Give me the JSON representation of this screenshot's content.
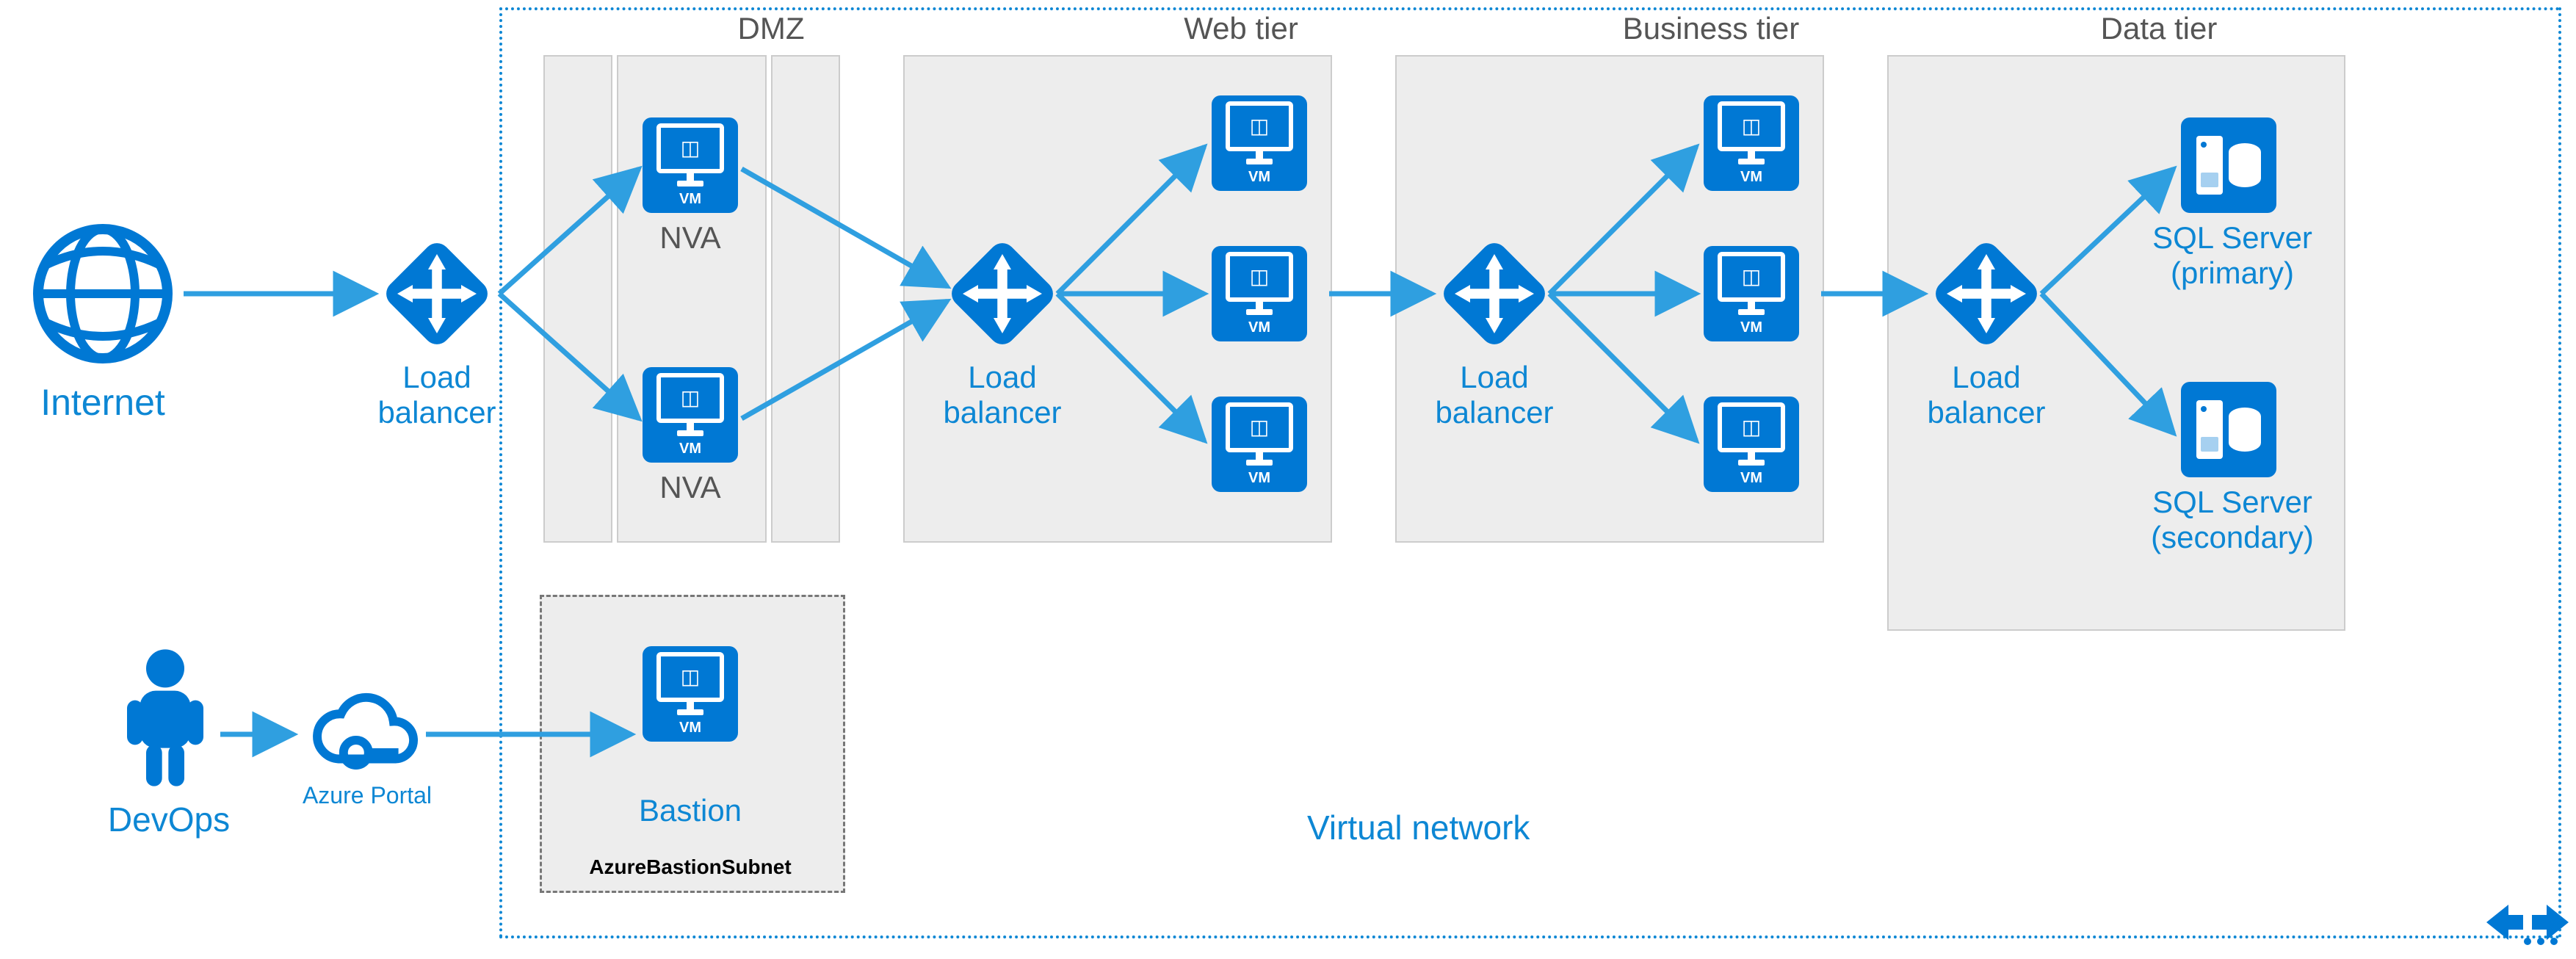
{
  "labels": {
    "internet": "Internet",
    "devops": "DevOps",
    "azurePortal": "Azure Portal",
    "bastion": "Bastion",
    "bastionSubnet": "AzureBastionSubnet",
    "virtualNetwork": "Virtual network",
    "loadBalancer": "Load\nbalancer",
    "nva": "NVA",
    "vmTag": "VM",
    "sqlPrimary": "SQL Server\n(primary)",
    "sqlSecondary": "SQL Server\n(secondary)"
  },
  "tiers": {
    "dmz": "DMZ",
    "web": "Web tier",
    "business": "Business tier",
    "data": "Data tier"
  },
  "colors": {
    "azureBlue": "#0078d4",
    "linkBlue": "#0d87d4",
    "panel": "#ededed"
  }
}
